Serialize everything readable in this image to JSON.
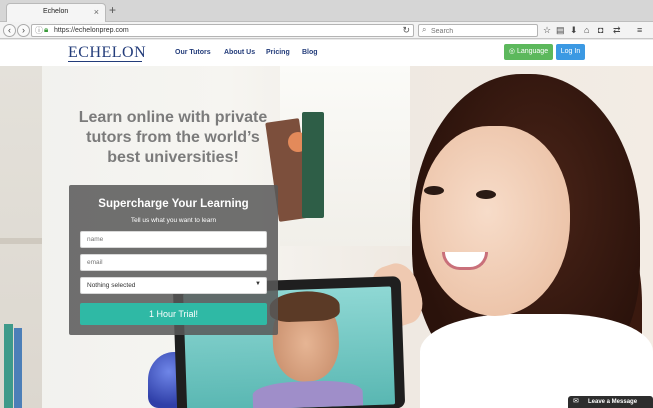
{
  "browser": {
    "tab_title": "Echelon",
    "tab_close": "×",
    "new_tab": "+",
    "url": "https://echelonprep.com",
    "search_placeholder": "Search"
  },
  "site": {
    "logo": "ECHELON",
    "nav": [
      "Our Tutors",
      "About Us",
      "Pricing",
      "Blog"
    ],
    "language_button": "Language",
    "login_button": "Log In"
  },
  "hero": {
    "title": "Learn online with private tutors from the world’s best universities!"
  },
  "signup_form": {
    "title": "Supercharge Your Learning",
    "subtitle": "Tell us what you want to learn",
    "name_placeholder": "name",
    "email_placeholder": "email",
    "select_value": "Nothing selected",
    "submit_label": "1 Hour Trial!"
  },
  "chat": {
    "label": "Leave a Message"
  },
  "colors": {
    "brand_navy": "#233c7a",
    "language_green": "#5cb85c",
    "login_blue": "#3b99e3",
    "trial_teal": "#2fb9a5"
  }
}
